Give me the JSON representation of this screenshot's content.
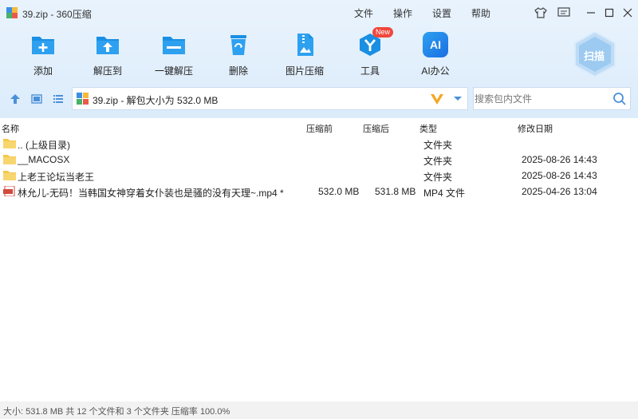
{
  "window": {
    "title": "39.zip - 360压缩"
  },
  "menu": {
    "file": "文件",
    "operate": "操作",
    "settings": "设置",
    "help": "帮助"
  },
  "toolbar": {
    "add": "添加",
    "extract_to": "解压到",
    "one_click_extract": "一键解压",
    "delete": "删除",
    "image_compress": "图片压缩",
    "tools": "工具",
    "tools_badge": "New",
    "ai_office": "AI办公",
    "ai_icon_text": "AI",
    "scan": "扫描"
  },
  "address": {
    "path": "39.zip - 解包大小为 532.0 MB"
  },
  "search": {
    "placeholder": "搜索包内文件",
    "value": ""
  },
  "columns": {
    "name": "名称",
    "size_before": "压缩前",
    "size_after": "压缩后",
    "type": "类型",
    "modified": "修改日期"
  },
  "files": [
    {
      "name": ".. (上级目录)",
      "before": "",
      "after": "",
      "type": "文件夹",
      "modified": ""
    },
    {
      "name": "__MACOSX",
      "before": "",
      "after": "",
      "type": "文件夹",
      "modified": "2025-08-26 14:43"
    },
    {
      "name": "上老王论坛当老王",
      "before": "",
      "after": "",
      "type": "文件夹",
      "modified": "2025-08-26 14:43"
    },
    {
      "name": "林允儿-无码！当韩国女神穿着女仆装也是骚的没有天理~.mp4 *",
      "before": "532.0 MB",
      "after": "531.8 MB",
      "type": "MP4 文件",
      "modified": "2025-04-26 13:04"
    }
  ],
  "status": {
    "text": "大小: 531.8 MB 共 12 个文件和 3 个文件夹 压缩率 100.0%"
  },
  "colors": {
    "accent": "#1a8fe3",
    "toolbar_bg": "#e3effc",
    "badge": "#f0473c",
    "folder": "#f5c84c"
  }
}
